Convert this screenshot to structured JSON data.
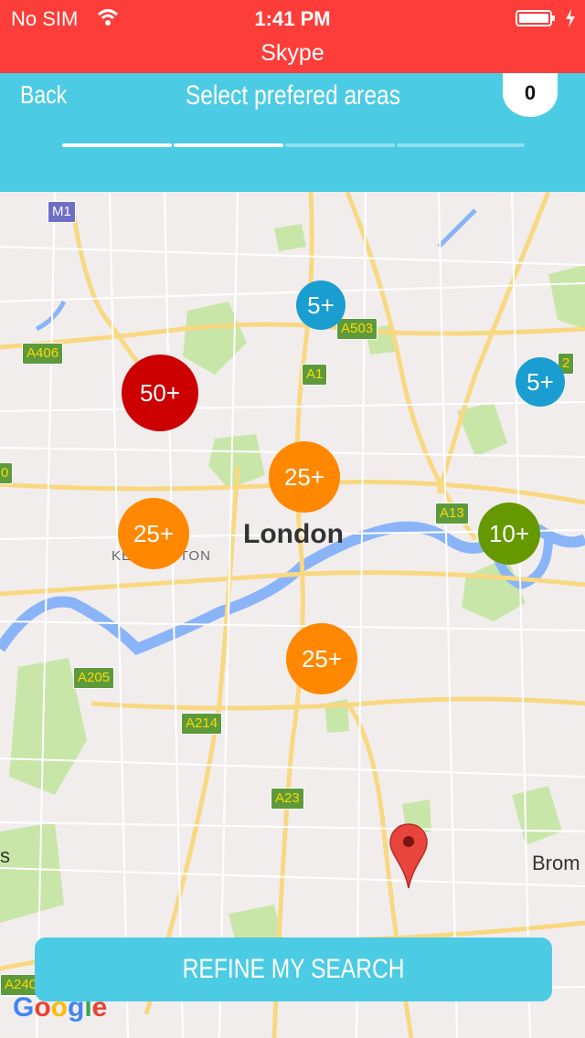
{
  "status_bar": {
    "carrier": "No SIM",
    "time": "1:41 PM",
    "app": "Skype",
    "icons": [
      "wifi-icon",
      "battery-icon",
      "charging-icon"
    ],
    "color": "#fc3d39"
  },
  "header": {
    "back_label": "Back",
    "title": "Select prefered areas",
    "badge_count": "0",
    "color": "#4ccbe4",
    "steps": [
      {
        "state": "active"
      },
      {
        "state": "active"
      },
      {
        "state": "inactive"
      },
      {
        "state": "inactive"
      }
    ]
  },
  "map": {
    "city": "London",
    "area": "KENSINGTON",
    "place": "Brom",
    "left_edge_label": "s",
    "roads": [
      "M1",
      "A503",
      "A406",
      "A1",
      "A13",
      "A205",
      "A214",
      "A23",
      "A240",
      "0",
      "2"
    ],
    "clusters": [
      {
        "label": "5+",
        "color": "#1a9dd0"
      },
      {
        "label": "5+",
        "color": "#1a9dd0"
      },
      {
        "label": "50+",
        "color": "#cc0000"
      },
      {
        "label": "25+",
        "color": "#ff8800"
      },
      {
        "label": "25+",
        "color": "#ff8800"
      },
      {
        "label": "10+",
        "color": "#669900"
      },
      {
        "label": "25+",
        "color": "#ff8800"
      }
    ],
    "attribution": "Google"
  },
  "actions": {
    "refine_label": "REFINE MY SEARCH"
  }
}
